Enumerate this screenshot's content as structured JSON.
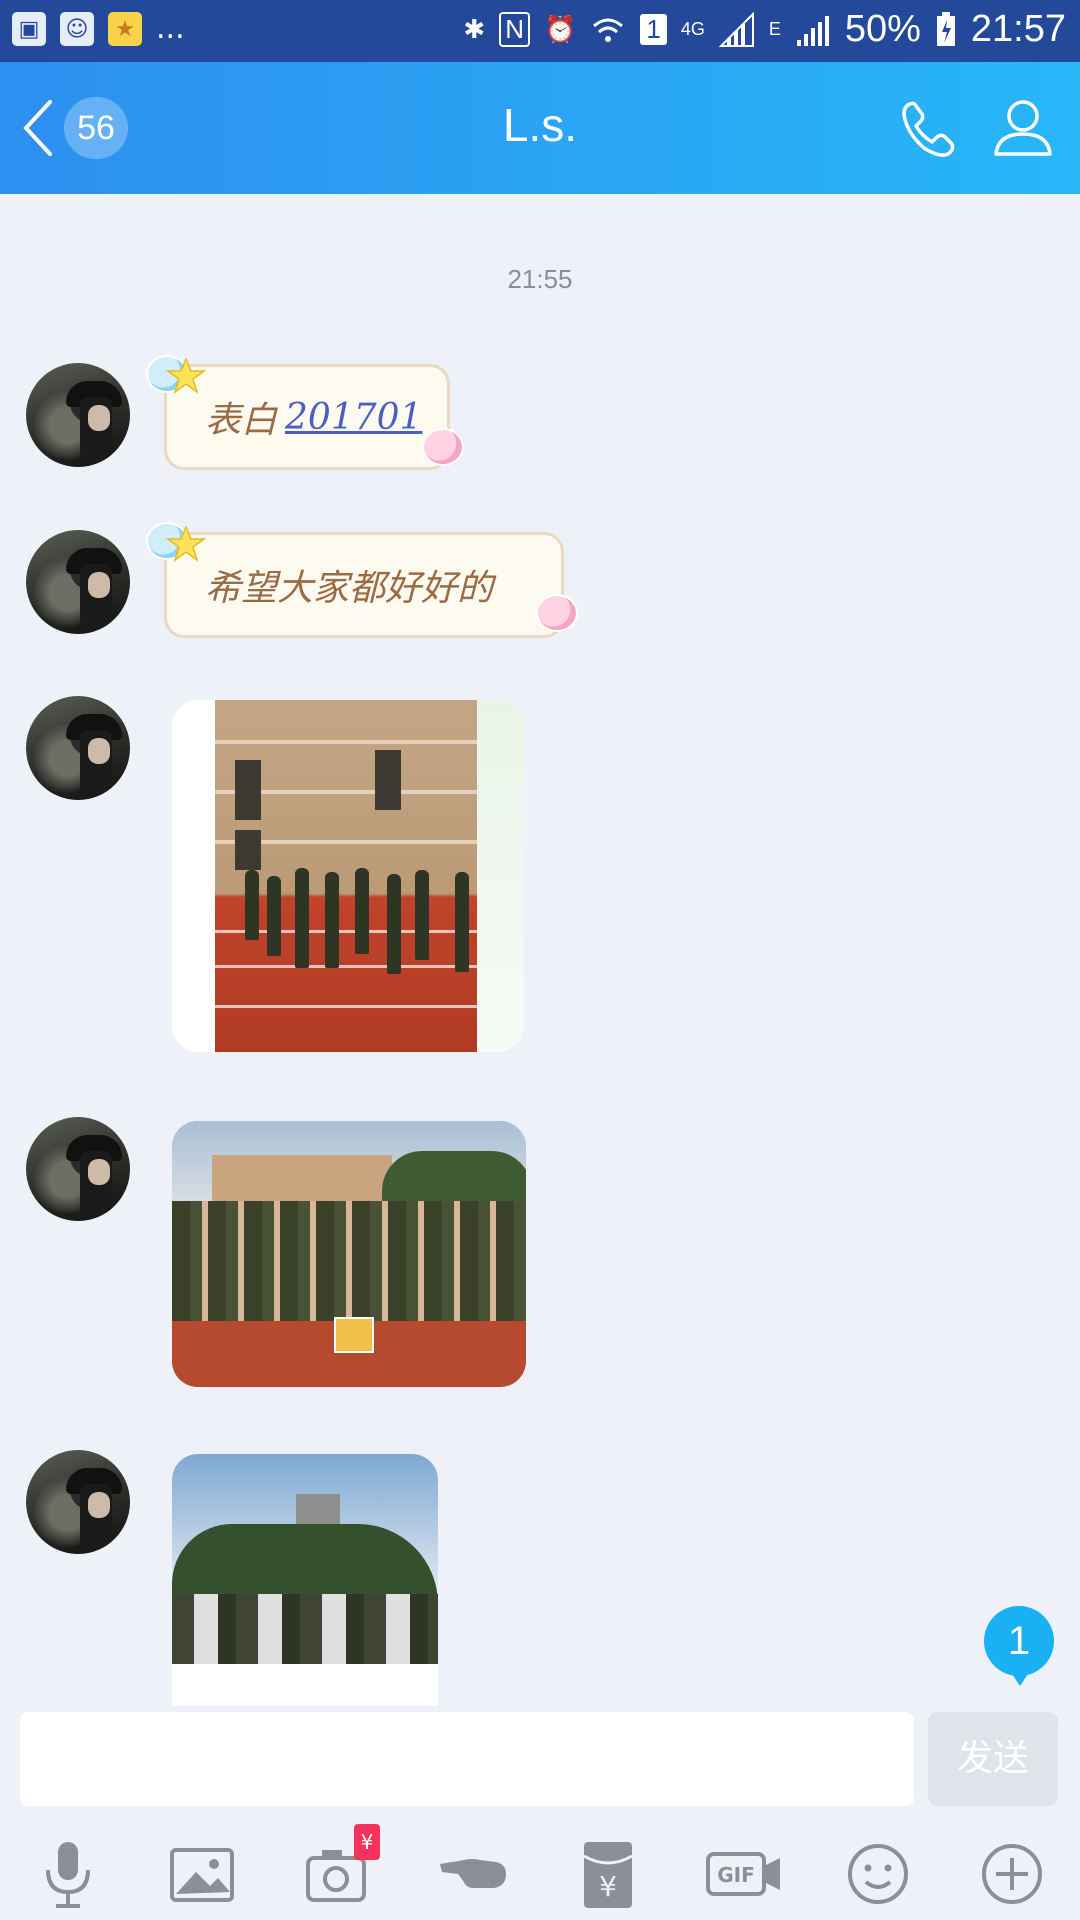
{
  "status_bar": {
    "battery": "50%",
    "time": "21:57",
    "network_4g": "4G",
    "network_e": "E",
    "sim": "1",
    "more": "...",
    "icons": [
      "gallery-icon",
      "qq-icon",
      "favorites-icon",
      "bluetooth-icon",
      "nfc-icon",
      "alarm-icon",
      "wifi-icon",
      "sim-icon",
      "signal-icon",
      "battery-icon"
    ]
  },
  "header": {
    "unread_count": "56",
    "title": "L.s.",
    "back_icon": "back-chevron-icon",
    "call_icon": "phone-icon",
    "profile_icon": "user-profile-icon",
    "accent_start": "#2d8ff0",
    "accent_end": "#27b7f7"
  },
  "chat": {
    "timestamp": "21:55",
    "messages": [
      {
        "type": "sticker_text",
        "text": "表白",
        "link": "201701"
      },
      {
        "type": "sticker_text",
        "text": "希望大家都好好的"
      },
      {
        "type": "image",
        "description_icon": "photo-message"
      },
      {
        "type": "image",
        "description_icon": "photo-message"
      },
      {
        "type": "image",
        "description_icon": "photo-message"
      }
    ],
    "new_message_count": "1"
  },
  "input": {
    "placeholder": "",
    "value": "",
    "send_label": "发送"
  },
  "toolbar": {
    "rmb_symbol": "¥",
    "gif_label": "GIF",
    "tools": [
      "microphone-icon",
      "image-picker-icon",
      "camera-icon",
      "poke-icon",
      "red-packet-icon",
      "gif-icon",
      "emoji-icon",
      "more-plus-icon"
    ]
  }
}
